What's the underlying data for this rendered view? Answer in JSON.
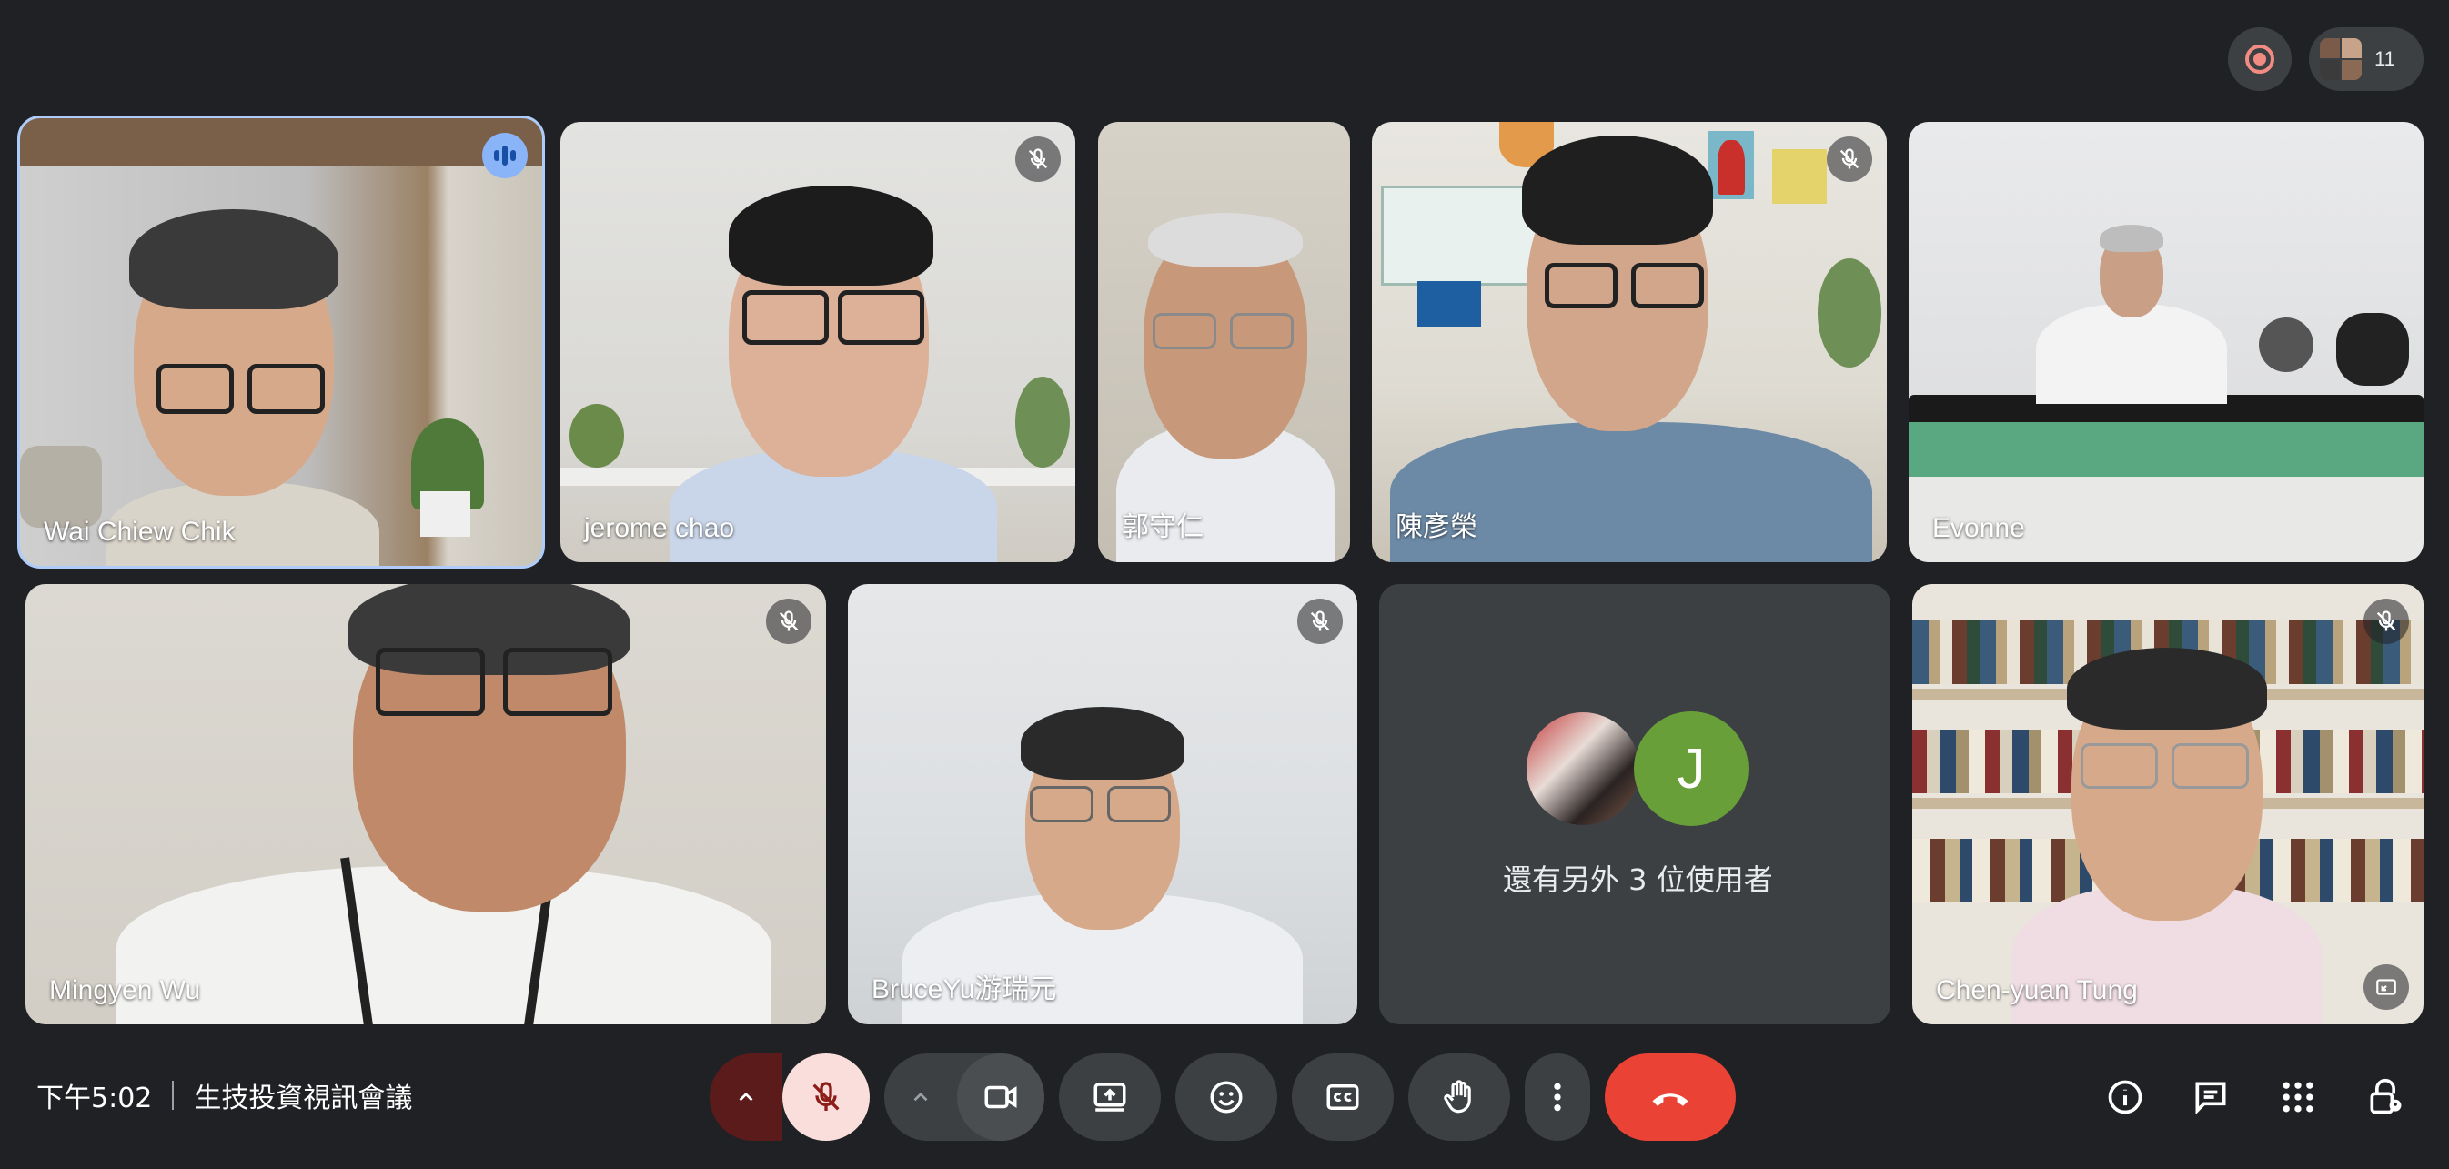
{
  "top": {
    "record_icon": "record-icon",
    "participant_count": "11"
  },
  "tiles": [
    {
      "name": "Wai Chiew Chik",
      "state": "speaking"
    },
    {
      "name": "jerome chao",
      "state": "muted"
    },
    {
      "name": "郭守仁",
      "state": "normal"
    },
    {
      "name": "陳彥榮",
      "state": "muted"
    },
    {
      "name": "Evonne",
      "state": "normal"
    },
    {
      "name": "Mingyen Wu",
      "state": "muted"
    },
    {
      "name": "BruceYu游瑞元",
      "state": "muted"
    },
    {
      "name": "Chen-yuan Tung",
      "state": "muted"
    }
  ],
  "others": {
    "avatar_letter": "J",
    "text": "還有另外 3 位使用者"
  },
  "bottom": {
    "time": "下午5:02",
    "meeting_title": "生技投資視訊會議",
    "controls": [
      "mic-options",
      "mic-muted",
      "camera-options",
      "camera",
      "present-screen",
      "reactions",
      "captions",
      "raise-hand",
      "more-options",
      "leave-call"
    ],
    "right_controls": [
      "meeting-info",
      "chat",
      "activities",
      "host-controls"
    ]
  },
  "colors": {
    "background": "#202124",
    "control": "#3c4043",
    "mic_muted_bg": "#f9dedc",
    "mic_group_dark": "#5c1b1b",
    "end_call": "#ea4335",
    "active_speaker": "#aecbfa"
  }
}
